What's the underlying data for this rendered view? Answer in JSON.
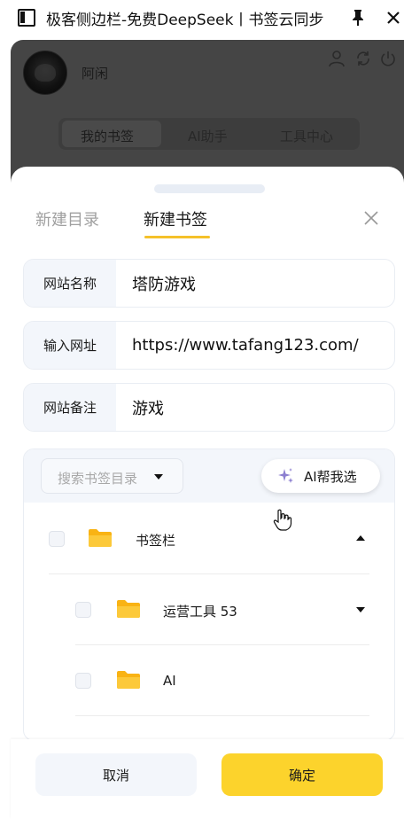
{
  "window": {
    "title": "极客侧边栏-免费DeepSeek丨书签云同步"
  },
  "profile": {
    "username": "阿闲"
  },
  "nav_tabs": [
    "我的书签",
    "AI助手",
    "工具中心"
  ],
  "sheet": {
    "tabs": [
      "新建目录",
      "新建书签"
    ],
    "active_tab": "新建书签"
  },
  "form": {
    "fields": [
      {
        "label": "网站名称",
        "value": "塔防游戏"
      },
      {
        "label": "输入网址",
        "value": "https://www.tafang123.com/"
      },
      {
        "label": "网站备注",
        "value": "游戏"
      }
    ]
  },
  "tree": {
    "search_placeholder": "搜索书签目录",
    "ai_button": "AI帮我选",
    "items": [
      {
        "label": "书签栏",
        "expanded": true,
        "checked": false
      },
      {
        "label": "运营工具 53",
        "expanded": false,
        "checked": false
      },
      {
        "label": "AI",
        "checked": false
      }
    ]
  },
  "footer": {
    "cancel": "取消",
    "confirm": "确定"
  },
  "colors": {
    "accent": "#fcd32c",
    "overlay": "#454545",
    "folder": "#fbbf24"
  }
}
